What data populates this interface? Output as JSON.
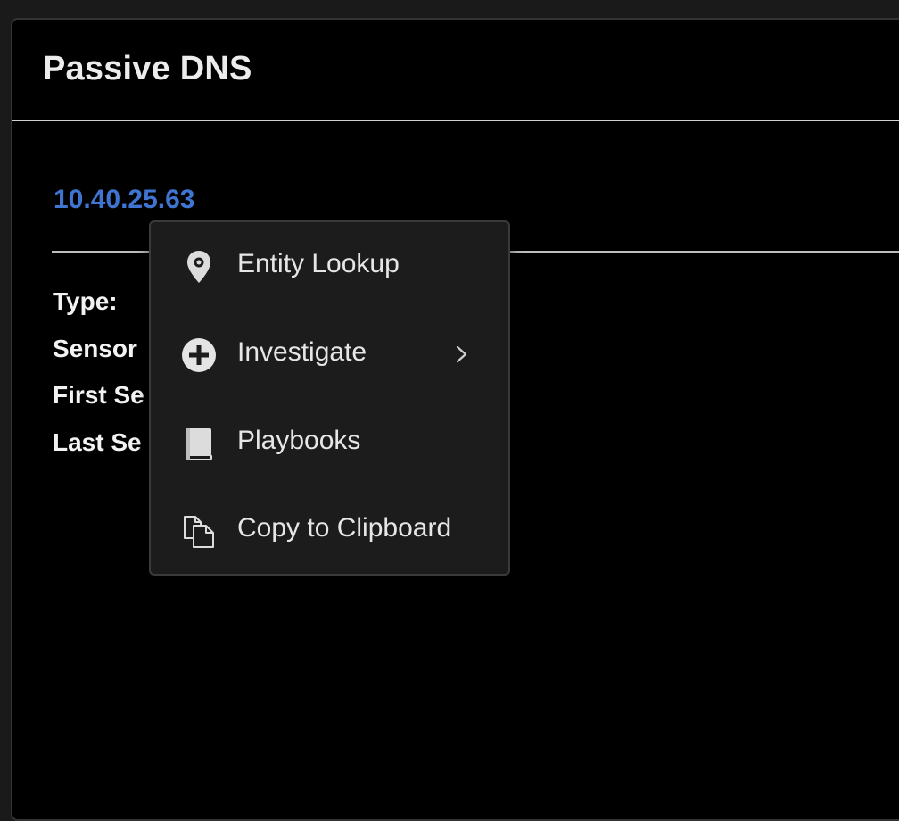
{
  "panel": {
    "title": "Passive DNS"
  },
  "record": {
    "ip": "10.40.25.63",
    "fields": [
      {
        "label": "Type:"
      },
      {
        "label": "Sensor"
      },
      {
        "label": "First Se"
      },
      {
        "label": "Last Se"
      }
    ]
  },
  "context_menu": {
    "items": [
      {
        "label": "Entity Lookup",
        "icon": "map-pin-icon"
      },
      {
        "label": "Investigate",
        "icon": "plus-circle-icon",
        "has_submenu": true
      },
      {
        "label": "Playbooks",
        "icon": "book-icon"
      },
      {
        "label": "Copy to Clipboard",
        "icon": "copy-icon"
      }
    ]
  },
  "colors": {
    "background": "#000000",
    "link": "#3f74d1",
    "menu_bg": "#1c1c1c",
    "text": "#e6e6e6"
  }
}
